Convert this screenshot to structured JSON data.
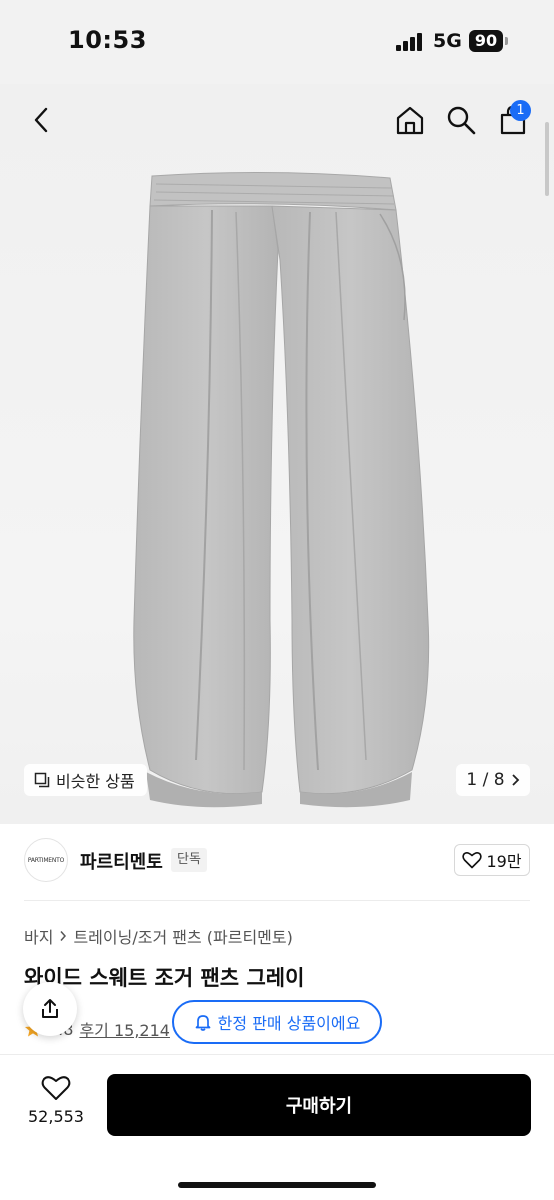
{
  "status": {
    "time": "10:53",
    "network": "5G",
    "battery": "90"
  },
  "header": {
    "cart_count": "1"
  },
  "hero": {
    "similar_label": "비슷한 상품",
    "pager": "1 / 8"
  },
  "brand": {
    "logo_text": "PARTIMENTO",
    "name": "파르티멘토",
    "tag": "단독",
    "likes": "19만"
  },
  "breadcrumb": {
    "category": "바지",
    "subcategory": "트레이닝/조거 팬츠 (파르티멘토)"
  },
  "product": {
    "title": "와이드 스웨트 조거 팬츠 그레이",
    "rating": "4.8",
    "reviews": "후기 15,214"
  },
  "toast": {
    "limited": "한정 판매 상품이에요"
  },
  "bottom": {
    "wish_count": "52,553",
    "buy_label": "구매하기"
  },
  "colors": {
    "accent": "#1a6cf6",
    "buy_button": "#000000",
    "pants_gray": "#bdbdbd"
  }
}
